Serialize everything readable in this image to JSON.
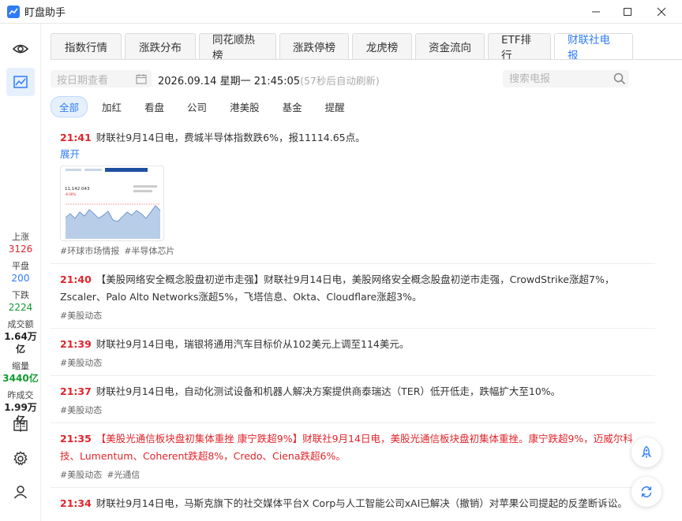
{
  "app": {
    "title": "盯盘助手"
  },
  "window": {
    "minimize": "—",
    "maximize": "☐",
    "close": "✕"
  },
  "rail": {
    "icons": [
      "eye-icon",
      "chart-icon",
      "book-icon",
      "gear-icon",
      "user-icon"
    ],
    "stats": [
      {
        "label": "上涨",
        "value": "3126",
        "color": "#e0242a"
      },
      {
        "label": "平盘",
        "value": "200",
        "color": "#2f7cf6"
      },
      {
        "label": "下跌",
        "value": "2224",
        "color": "#119b30"
      },
      {
        "label": "成交额",
        "value": "1.64万亿",
        "color": "#222222"
      },
      {
        "label": "缩量",
        "value": "3440亿",
        "color": "#119b30"
      },
      {
        "label": "昨成交",
        "value": "1.99万亿",
        "color": "#222222"
      }
    ]
  },
  "tabs": [
    "指数行情",
    "涨跌分布",
    "同花顺热榜",
    "涨跌停榜",
    "龙虎榜",
    "资金流向",
    "ETF排行",
    "财联社电报"
  ],
  "active_tab": 7,
  "toolbar": {
    "date_placeholder": "按日期查看",
    "datetime": "2026.09.14 星期一 21:45:05",
    "refresh_hint": "(57秒后自动刷新)",
    "search_placeholder": "搜索电报"
  },
  "filters": [
    "全部",
    "加红",
    "看盘",
    "公司",
    "港美股",
    "基金",
    "提醒"
  ],
  "active_filter": 0,
  "feed": [
    {
      "time": "21:41",
      "text": "财联社9月14日电，费城半导体指数跌6%，报11114.65点。",
      "expand": "展开",
      "has_image": true,
      "tags": [
        "#环球市场情报",
        "#半导体芯片"
      ],
      "hot": false
    },
    {
      "time": "21:40",
      "text": "【美股网络安全概念股盘初逆市走强】财联社9月14日电，美股网络安全概念股盘初逆市走强，CrowdStrike涨超7%，Zscaler、Palo Alto Networks涨超5%，飞塔信息、Okta、Cloudflare涨超3%。",
      "tags": [
        "#美股动态"
      ],
      "hot": false
    },
    {
      "time": "21:39",
      "text": "财联社9月14日电，瑞银将通用汽车目标价从102美元上调至114美元。",
      "tags": [
        "#美股动态"
      ],
      "hot": false
    },
    {
      "time": "21:37",
      "text": "财联社9月14日电，自动化测试设备和机器人解决方案提供商泰瑞达（TER）低开低走，跌幅扩大至10%。",
      "tags": [
        "#美股动态"
      ],
      "hot": false
    },
    {
      "time": "21:35",
      "text": "【美股光通信板块盘初集体重挫 康宁跌超9%】财联社9月14日电，美股光通信板块盘初集体重挫。康宁跌超9%，迈威尔科技、Lumentum、Coherent跌超8%，Credo、Ciena跌超6%。",
      "tags": [
        "#美股动态",
        "#光通信"
      ],
      "hot": true
    },
    {
      "time": "21:34",
      "text": "财联社9月14日电，马斯克旗下的社交媒体平台X Corp与人工智能公司xAI已解决（撤销）对苹果公司提起的反垄断诉讼。",
      "tags": [],
      "hot": false
    }
  ],
  "thumb": {
    "value": "11,142.043",
    "sub": "-6.00%"
  },
  "accent": "#2f7cf6",
  "up_color": "#e0242a",
  "down_color": "#119b30"
}
